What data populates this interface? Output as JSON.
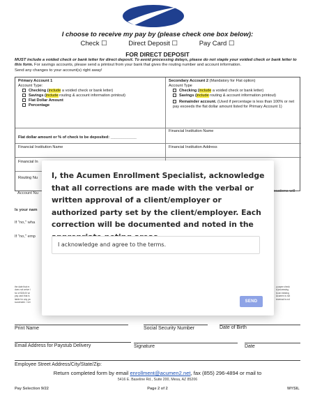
{
  "form": {
    "choose_heading": "I choose to receive my pay by (please check one box below):",
    "options": [
      "Check ☐",
      "Direct Deposit ☐",
      "Pay Card ☐"
    ],
    "direct_deposit_title": "FOR DIRECT DEPOSIT",
    "must_bold": "MUST include a voided check or bank letter for direct deposit. To avoid processing delays, please do not staple your voided check or bank letter to this form.",
    "must_rest": " For savings accounts, please send a printout from your bank that gives the routing number and account information.",
    "must_line3": "Send any changes to your account(s) right away!",
    "primary": {
      "title": "Primary Account 1",
      "account_type": "Account Type:",
      "checking_a": "Checking (",
      "checking_hl": "include",
      "checking_b": " a voided check or bank letter)",
      "savings_a": "Savings (",
      "savings_hl": "include",
      "savings_b": " routing & account information printout)",
      "flat": "Flat Dollar Amount",
      "percentage": "Percentage"
    },
    "secondary": {
      "title_bold": "Secondary Account 2",
      "title_rest": " (Mandatory for Flat option)",
      "account_type": "Account Type",
      "checking_a": "Checking (",
      "checking_hl": "include",
      "checking_b": " a voided check or bank letter)",
      "savings_a": "Savings (",
      "savings_hl": "include",
      "savings_b": " routing & account information printout)",
      "remainder_bold": "Remainder account.",
      "remainder_rest": " (Used if percentage is less than 100% or net pay exceeds the flat dollar amount listed for Primary Account 1)"
    },
    "flat_label": "Flat dollar amount or % of check to be deposited: ____________",
    "fi_name_label": "Financial Institution Name",
    "fi_name_label_2": "Financial Institution Name",
    "fi_address_label": "Financial Institution Address",
    "fi_partial": "Financial In",
    "routing_partial": "Routing Nu",
    "account_partial": "Account Nu",
    "locations_partial": "ocations  will",
    "your_name_partial": "Is your nam",
    "if_no_what": "If \"no,\" wha",
    "if_no_emp": "If \"no,\" emp",
    "fine_left": "the date that m\ndoes not arrive i\nfor of $35.00 wi\npay card that is\nliable for any pa\nsuccessful. I ver",
    "fine_right": "y paper check\na processing\nto an existing\nAcumen is not\nreversal is not",
    "signatures": {
      "print_name": "Print Name",
      "ssn": "Social Security Number",
      "dob": "Date of Birth",
      "email": "Email Address for Paystub Delivery",
      "signature": "Signature",
      "date": "Date",
      "street": "Employee Street Address/City/State/Zip:"
    },
    "return_a": "Return completed form by email ",
    "return_email": "enrollment@acumen2.net",
    "return_b": ", fax (855) 296-4894 or mail to",
    "address": "5416 E. Baseline Rd., Suite 200, Mesa, AZ 85206",
    "footer_left": "Pay Selection 9/22",
    "footer_center": "Page 2 of 2",
    "footer_right": "WYSIL"
  },
  "modal": {
    "statement": "I, the Acumen Enrollment Specialist, acknowledge that all corrections are made with the verbal or written approval of a client/employer or authorized party set by the client/employer. Each correction will be documented and noted in the appropriate noting areas.",
    "input_value": "I acknowledge and agree to the terms.",
    "send_label": "SEND"
  },
  "colors": {
    "logo_blue": "#1f3f8f",
    "highlight": "#f6ea3b",
    "send_button": "#8ea3e6",
    "link": "#1a4fb3"
  }
}
